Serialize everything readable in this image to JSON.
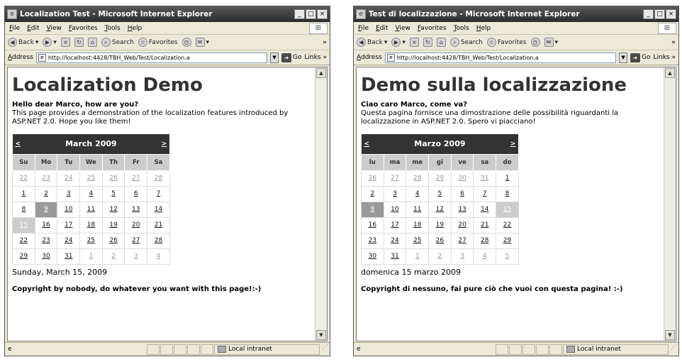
{
  "windows": [
    {
      "title": "Localization Test - Microsoft Internet Explorer",
      "menu": [
        "File",
        "Edit",
        "View",
        "Favorites",
        "Tools",
        "Help"
      ],
      "toolbar": {
        "back": "Back",
        "search": "Search",
        "favorites": "Favorites",
        "more": "»"
      },
      "address": {
        "label": "Address",
        "url": "http://localhost:4428/TBH_Web/Test/Localization.a",
        "go": "Go",
        "links": "Links »"
      },
      "page": {
        "title": "Localization Demo",
        "greeting": "Hello dear Marco, how are you?",
        "description": "This page provides a demonstration of the localization features introduced by ASP.NET 2.0. Hope you like them!",
        "calendar": {
          "prev": "<",
          "next": ">",
          "month": "March 2009",
          "days": [
            "Su",
            "Mo",
            "Tu",
            "We",
            "Th",
            "Fr",
            "Sa"
          ],
          "weeks": [
            [
              "22",
              "23",
              "24",
              "25",
              "26",
              "27",
              "28"
            ],
            [
              "1",
              "2",
              "3",
              "4",
              "5",
              "6",
              "7"
            ],
            [
              "8",
              "9",
              "10",
              "11",
              "12",
              "13",
              "14"
            ],
            [
              "15",
              "16",
              "17",
              "18",
              "19",
              "20",
              "21"
            ],
            [
              "22",
              "23",
              "24",
              "25",
              "26",
              "27",
              "28"
            ],
            [
              "29",
              "30",
              "31",
              "1",
              "2",
              "3",
              "4"
            ]
          ]
        },
        "selected_date": "Sunday, March 15, 2009",
        "copyright": "Copyright by nobody, do whatever you want with this page!:-)"
      },
      "status": {
        "zone": "Local intranet"
      }
    },
    {
      "title": "Test di localizzazione - Microsoft Internet Explorer",
      "menu": [
        "File",
        "Edit",
        "View",
        "Favorites",
        "Tools",
        "Help"
      ],
      "toolbar": {
        "back": "Back",
        "search": "Search",
        "favorites": "Favorites",
        "more": "»"
      },
      "address": {
        "label": "Address",
        "url": "http://localhost:4428/TBH_Web/Test/Localization.a",
        "go": "Go",
        "links": "Links »"
      },
      "page": {
        "title": "Demo sulla localizzazione",
        "greeting": "Ciao caro Marco, come va?",
        "description": "Questa pagina fornisce una dimostrazione delle possibilità riguardanti la localizzazione in ASP.NET 2.0. Spero vi piacciano!",
        "calendar": {
          "prev": "<",
          "next": ">",
          "month": "Marzo 2009",
          "days": [
            "lu",
            "ma",
            "me",
            "gi",
            "ve",
            "sa",
            "do"
          ],
          "weeks": [
            [
              "26",
              "27",
              "28",
              "29",
              "30",
              "31",
              "1"
            ],
            [
              "2",
              "3",
              "4",
              "5",
              "6",
              "7",
              "8"
            ],
            [
              "9",
              "10",
              "11",
              "12",
              "13",
              "14",
              "15"
            ],
            [
              "16",
              "17",
              "18",
              "19",
              "20",
              "21",
              "22"
            ],
            [
              "23",
              "24",
              "25",
              "26",
              "27",
              "28",
              "29"
            ],
            [
              "30",
              "31",
              "1",
              "2",
              "3",
              "4",
              "5"
            ]
          ]
        },
        "selected_date": "domenica 15 marzo 2009",
        "copyright": "Copyright di nessuno, fai pure ciò che vuoi con questa pagina! :-)"
      },
      "status": {
        "zone": "Local intranet"
      }
    }
  ],
  "colors": {
    "calendar_header": "#333333",
    "day_header": "#cccccc",
    "today_cell": "#999999",
    "selected_cell": "#cccccc",
    "other_month_text": "#9a9a9a"
  },
  "icons": [
    "ie-page-icon",
    "windows-logo-icon",
    "back-icon",
    "forward-icon",
    "stop-icon",
    "refresh-icon",
    "home-icon",
    "search-icon",
    "favorites-icon",
    "history-icon",
    "mail-icon",
    "go-icon",
    "local-intranet-icon"
  ]
}
